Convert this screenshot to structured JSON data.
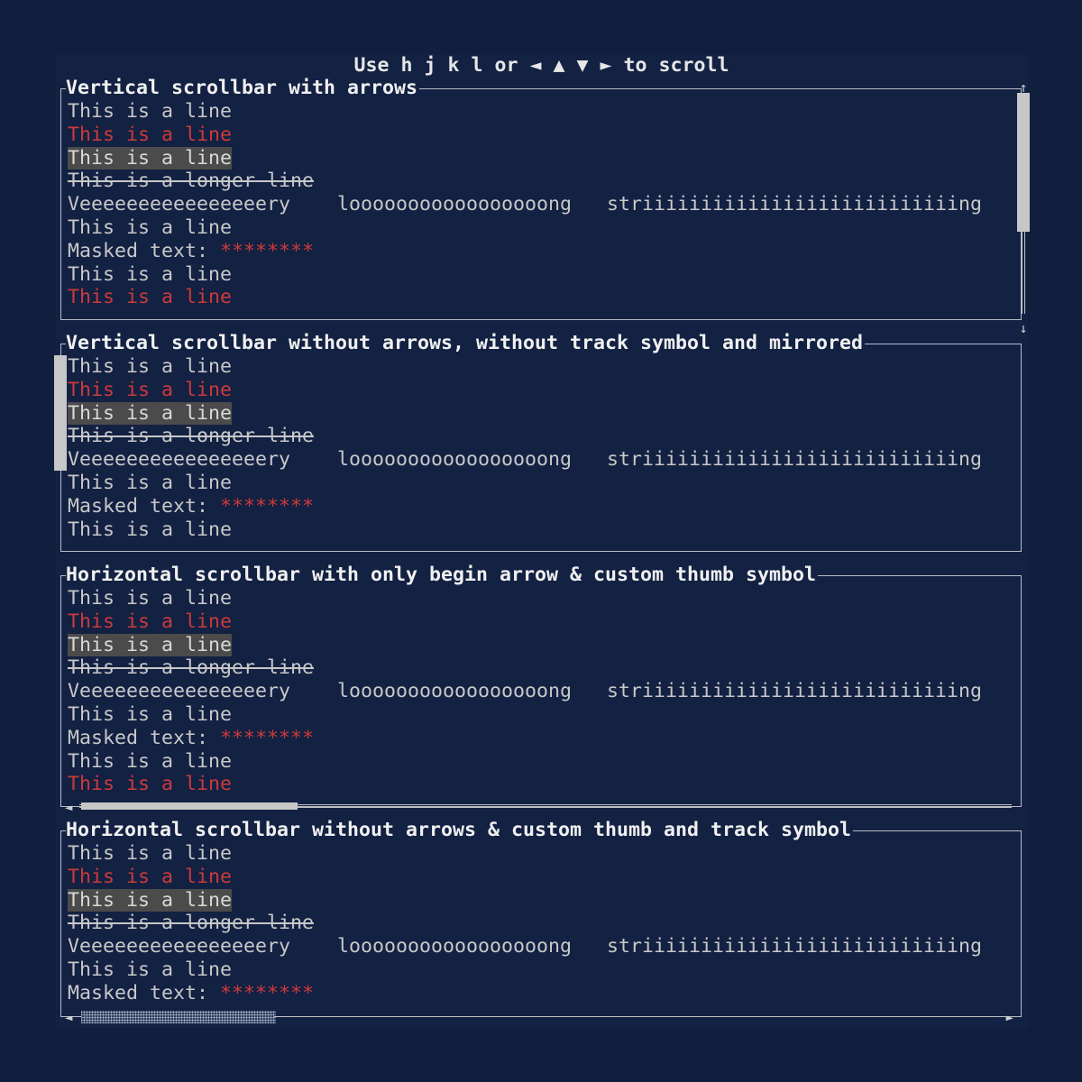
{
  "header": {
    "text": "Use h j k l or ◄ ▲ ▼ ► to scroll"
  },
  "blocks": [
    {
      "title": "Vertical scrollbar with arrows",
      "lines": [
        {
          "text": "This is a line",
          "style": "normal"
        },
        {
          "text": "This is a line",
          "style": "red"
        },
        {
          "text": "This is a line",
          "style": "highlight"
        },
        {
          "text": "This-is-a-longer-line",
          "style": "strike"
        },
        {
          "text": "Veeeeeeeeeeeeeeeery    looooooooooooooooong   striiiiiiiiiiiiiiiiiiiiiiiiiiing",
          "style": "normal"
        },
        {
          "text": "This is a line",
          "style": "normal"
        },
        {
          "label": "Masked text: ",
          "mask": "********",
          "style": "masked"
        },
        {
          "text": "This is a line",
          "style": "normal"
        },
        {
          "text": "This is a line",
          "style": "red"
        }
      ],
      "scrollbar": {
        "orientation": "vertical",
        "begin_arrow": "↑",
        "end_arrow": "↓",
        "position": 0.0
      }
    },
    {
      "title": "Vertical scrollbar without arrows, without track symbol and mirrored",
      "lines": [
        {
          "text": "This is a line",
          "style": "normal"
        },
        {
          "text": "This is a line",
          "style": "red"
        },
        {
          "text": "This is a line",
          "style": "highlight"
        },
        {
          "text": "This-is-a-longer-line",
          "style": "strike"
        },
        {
          "text": "Veeeeeeeeeeeeeeeery    looooooooooooooooong   striiiiiiiiiiiiiiiiiiiiiiiiiiing",
          "style": "normal"
        },
        {
          "text": "This is a line",
          "style": "normal"
        },
        {
          "label": "Masked text: ",
          "mask": "********",
          "style": "masked"
        },
        {
          "text": "This is a line",
          "style": "normal"
        }
      ],
      "scrollbar": {
        "orientation": "vertical-left",
        "position": 0.0
      }
    },
    {
      "title": "Horizontal scrollbar with only begin arrow & custom thumb symbol",
      "lines": [
        {
          "text": "This is a line",
          "style": "normal"
        },
        {
          "text": "This is a line",
          "style": "red"
        },
        {
          "text": "This is a line",
          "style": "highlight"
        },
        {
          "text": "This-is-a-longer-line",
          "style": "strike"
        },
        {
          "text": "Veeeeeeeeeeeeeeeery    looooooooooooooooong   striiiiiiiiiiiiiiiiiiiiiiiiiiing",
          "style": "normal"
        },
        {
          "text": "This is a line",
          "style": "normal"
        },
        {
          "label": "Masked text: ",
          "mask": "********",
          "style": "masked"
        },
        {
          "text": "This is a line",
          "style": "normal"
        },
        {
          "text": "This is a line",
          "style": "red"
        }
      ],
      "scrollbar": {
        "orientation": "horizontal",
        "begin_arrow": "◄",
        "position": 0.0
      }
    },
    {
      "title": "Horizontal scrollbar without arrows & custom thumb and track symbol",
      "lines": [
        {
          "text": "This is a line",
          "style": "normal"
        },
        {
          "text": "This is a line",
          "style": "red"
        },
        {
          "text": "This is a line",
          "style": "highlight"
        },
        {
          "text": "This-is-a-longer-line",
          "style": "strike"
        },
        {
          "text": "Veeeeeeeeeeeeeeeery    looooooooooooooooong   striiiiiiiiiiiiiiiiiiiiiiiiiiing",
          "style": "normal"
        },
        {
          "text": "This is a line",
          "style": "normal"
        },
        {
          "label": "Masked text: ",
          "mask": "********",
          "style": "masked"
        }
      ],
      "scrollbar": {
        "orientation": "horizontal",
        "begin_arrow": "◄",
        "end_arrow": "►",
        "position": 0.0
      }
    }
  ]
}
